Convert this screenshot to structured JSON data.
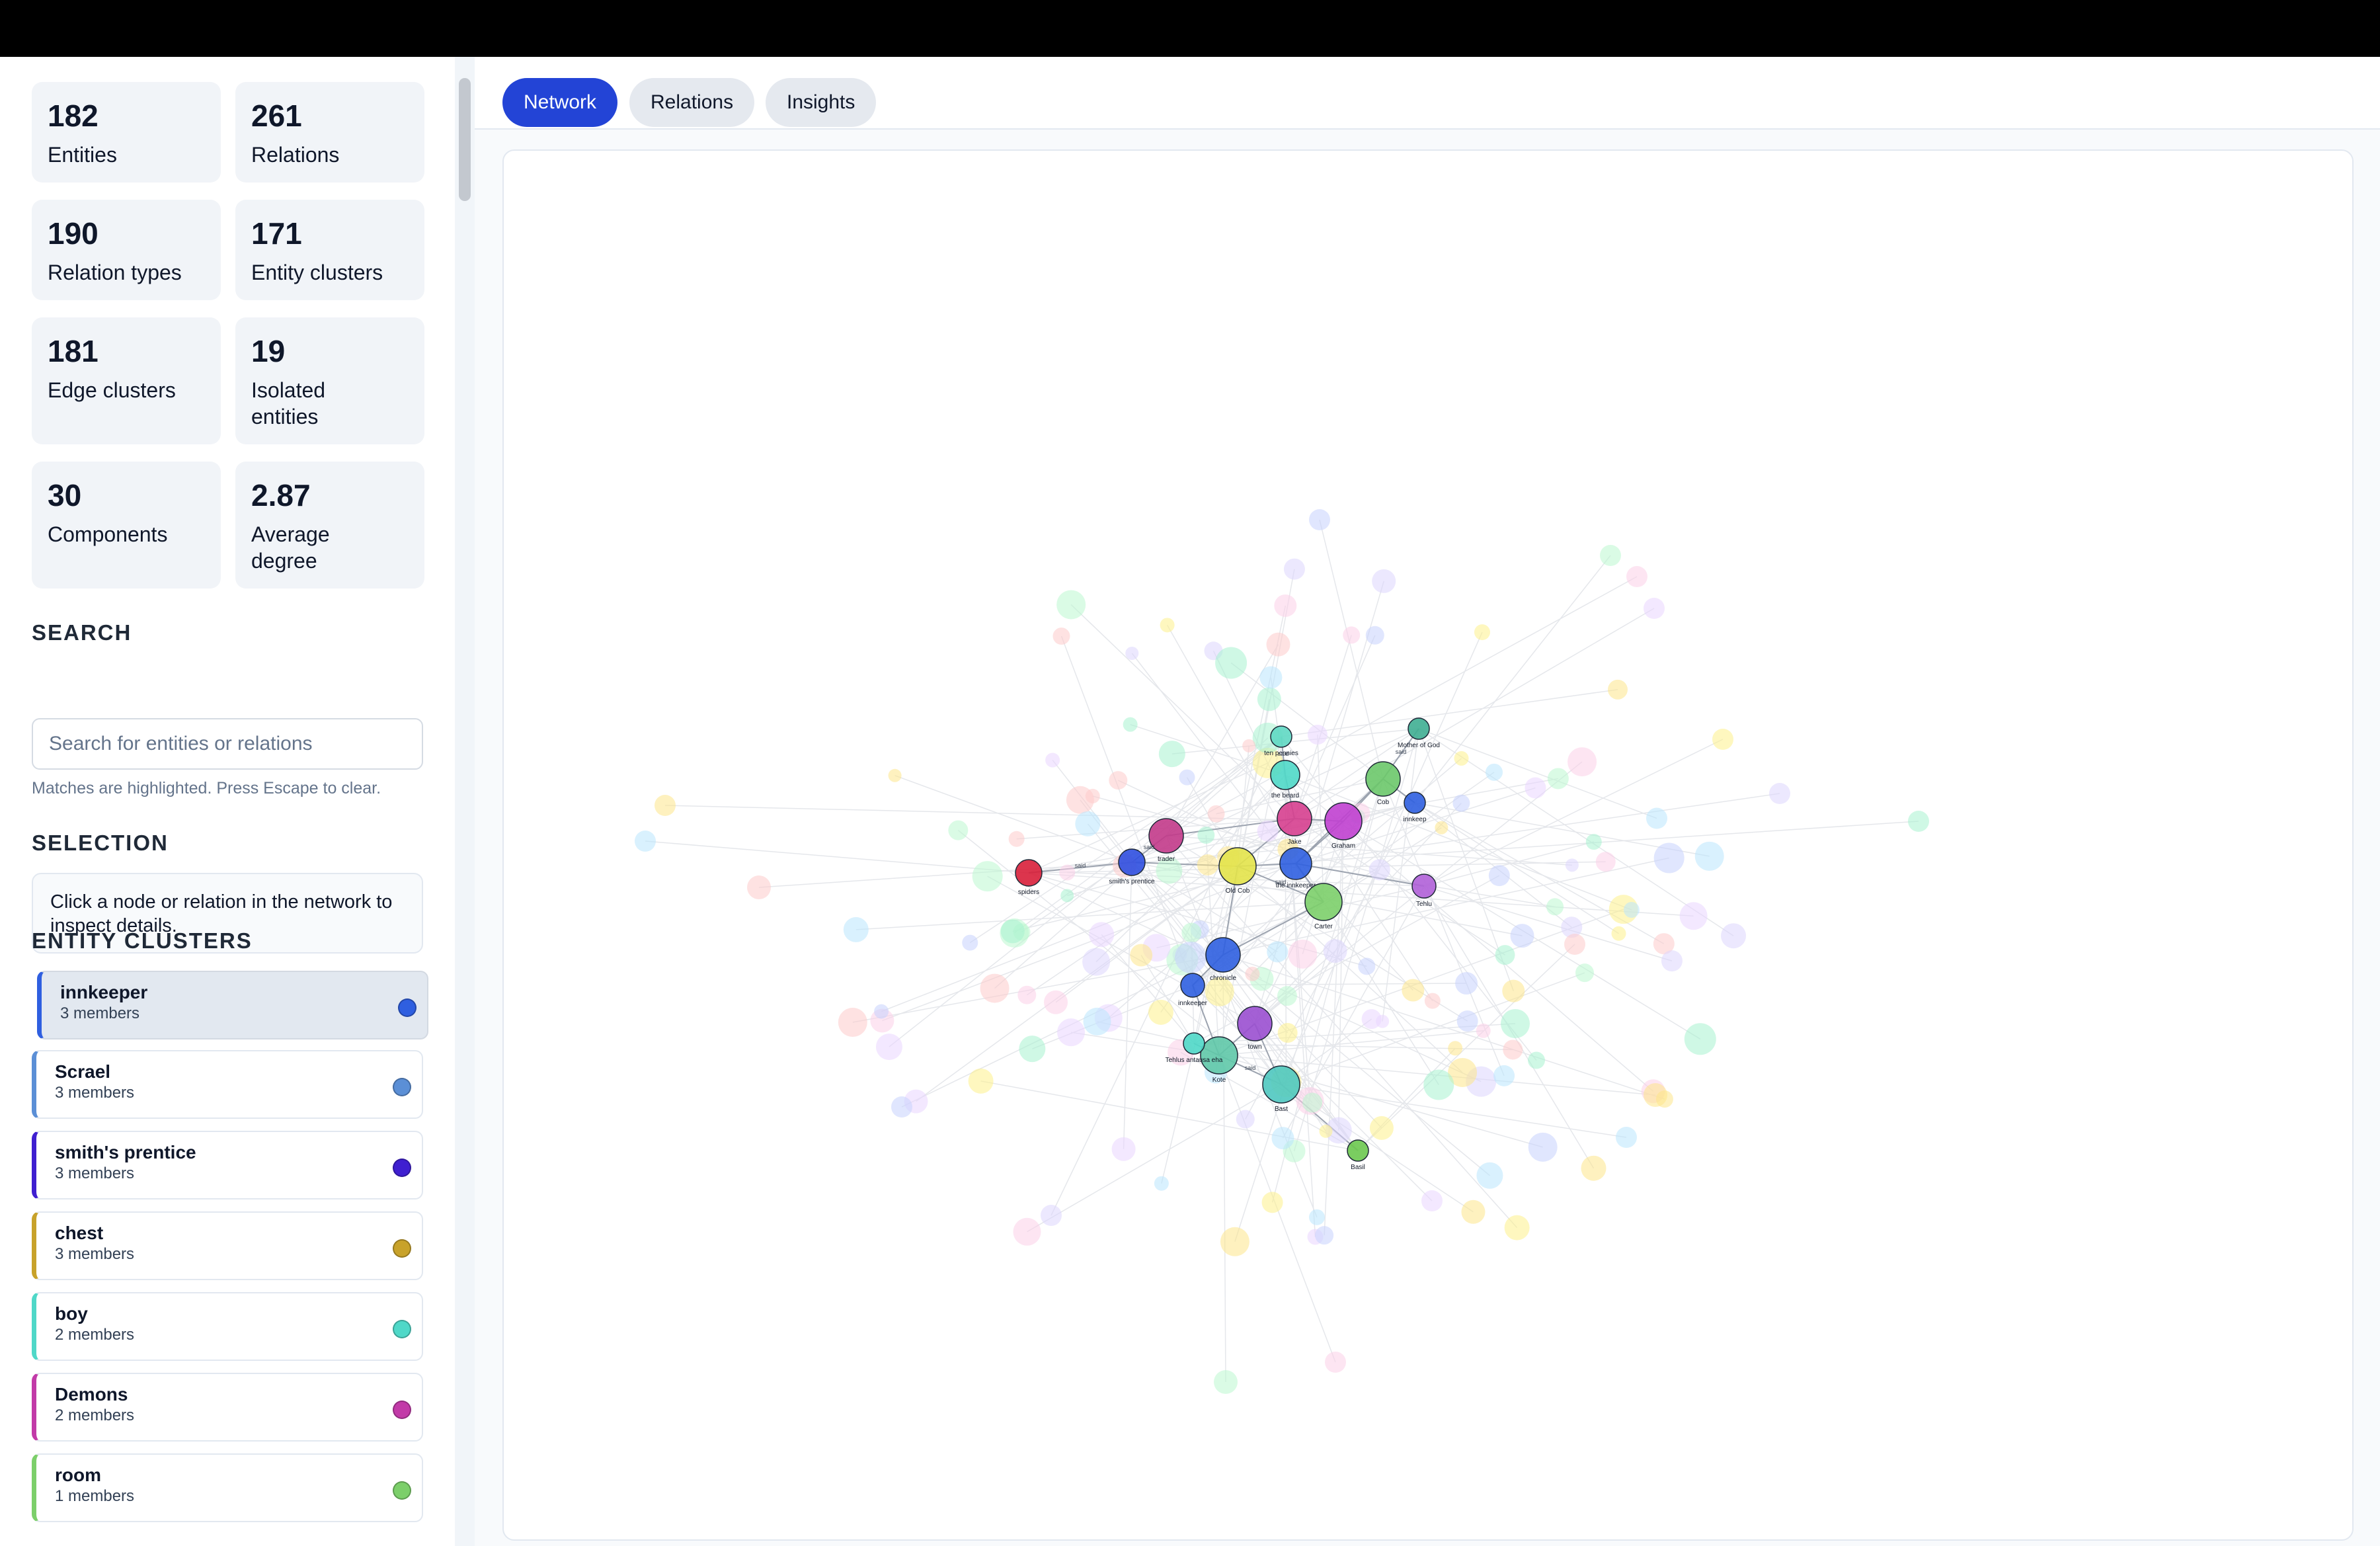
{
  "stats": [
    {
      "value": "182",
      "label": "Entities"
    },
    {
      "value": "261",
      "label": "Relations"
    },
    {
      "value": "190",
      "label": "Relation types"
    },
    {
      "value": "171",
      "label": "Entity clusters"
    },
    {
      "value": "181",
      "label": "Edge clusters"
    },
    {
      "value": "19",
      "label": "Isolated entities"
    },
    {
      "value": "30",
      "label": "Components"
    },
    {
      "value": "2.87",
      "label": "Average degree"
    }
  ],
  "search": {
    "title": "SEARCH",
    "placeholder": "Search for entities or relations",
    "hint": "Matches are highlighted. Press Escape to clear."
  },
  "selection": {
    "title": "SELECTION",
    "message": "Click a node or relation in the network to inspect details."
  },
  "entity_clusters": {
    "title": "ENTITY CLUSTERS",
    "items": [
      {
        "name": "innkeeper",
        "members": "3 members",
        "color": "#2f5fe0",
        "active": true
      },
      {
        "name": "Scrael",
        "members": "3 members",
        "color": "#5b8fd6"
      },
      {
        "name": "smith's prentice",
        "members": "3 members",
        "color": "#3f1fd0"
      },
      {
        "name": "chest",
        "members": "3 members",
        "color": "#c8a22a"
      },
      {
        "name": "boy",
        "members": "2 members",
        "color": "#4fd8c8"
      },
      {
        "name": "Demons",
        "members": "2 members",
        "color": "#c23aa8"
      },
      {
        "name": "room",
        "members": "1 members",
        "color": "#7ccf6a"
      }
    ]
  },
  "tabs": [
    {
      "label": "Network",
      "active": true
    },
    {
      "label": "Relations",
      "active": false
    },
    {
      "label": "Insights",
      "active": false
    }
  ],
  "graph": {
    "edge_label": "said",
    "nodes": [
      {
        "label": "ten pennies",
        "color": "#5fd8c3"
      },
      {
        "label": "Mother of God",
        "color": "#3fae92"
      },
      {
        "label": "the beard",
        "color": "#4fd8c8"
      },
      {
        "label": "Cob",
        "color": "#6cc86a"
      },
      {
        "label": "innkeep",
        "color": "#2f5fe0"
      },
      {
        "label": "trader",
        "color": "#c23a8a"
      },
      {
        "label": "Jake",
        "color": "#d63f8f"
      },
      {
        "label": "Graham",
        "color": "#c040d0"
      },
      {
        "label": "spiders",
        "color": "#d81f3a"
      },
      {
        "label": "smith's prentice",
        "color": "#2f4fe0"
      },
      {
        "label": "Old Cob",
        "color": "#e3e34a"
      },
      {
        "label": "the innkeeper",
        "color": "#2f5fe0"
      },
      {
        "label": "Tehlu",
        "color": "#b060d8"
      },
      {
        "label": "Carter",
        "color": "#7ccf6a"
      },
      {
        "label": "chronicle",
        "color": "#2f5fe0"
      },
      {
        "label": "innkeeper",
        "color": "#2f5fe0"
      },
      {
        "label": "town",
        "color": "#9a4fd0"
      },
      {
        "label": "Kote",
        "color": "#5fc8a8"
      },
      {
        "label": "Bast",
        "color": "#4fc8c0"
      },
      {
        "label": "Basil",
        "color": "#6cc84f"
      },
      {
        "label": "Tehlus antausa eha",
        "color": "#4fd8c8"
      }
    ]
  }
}
